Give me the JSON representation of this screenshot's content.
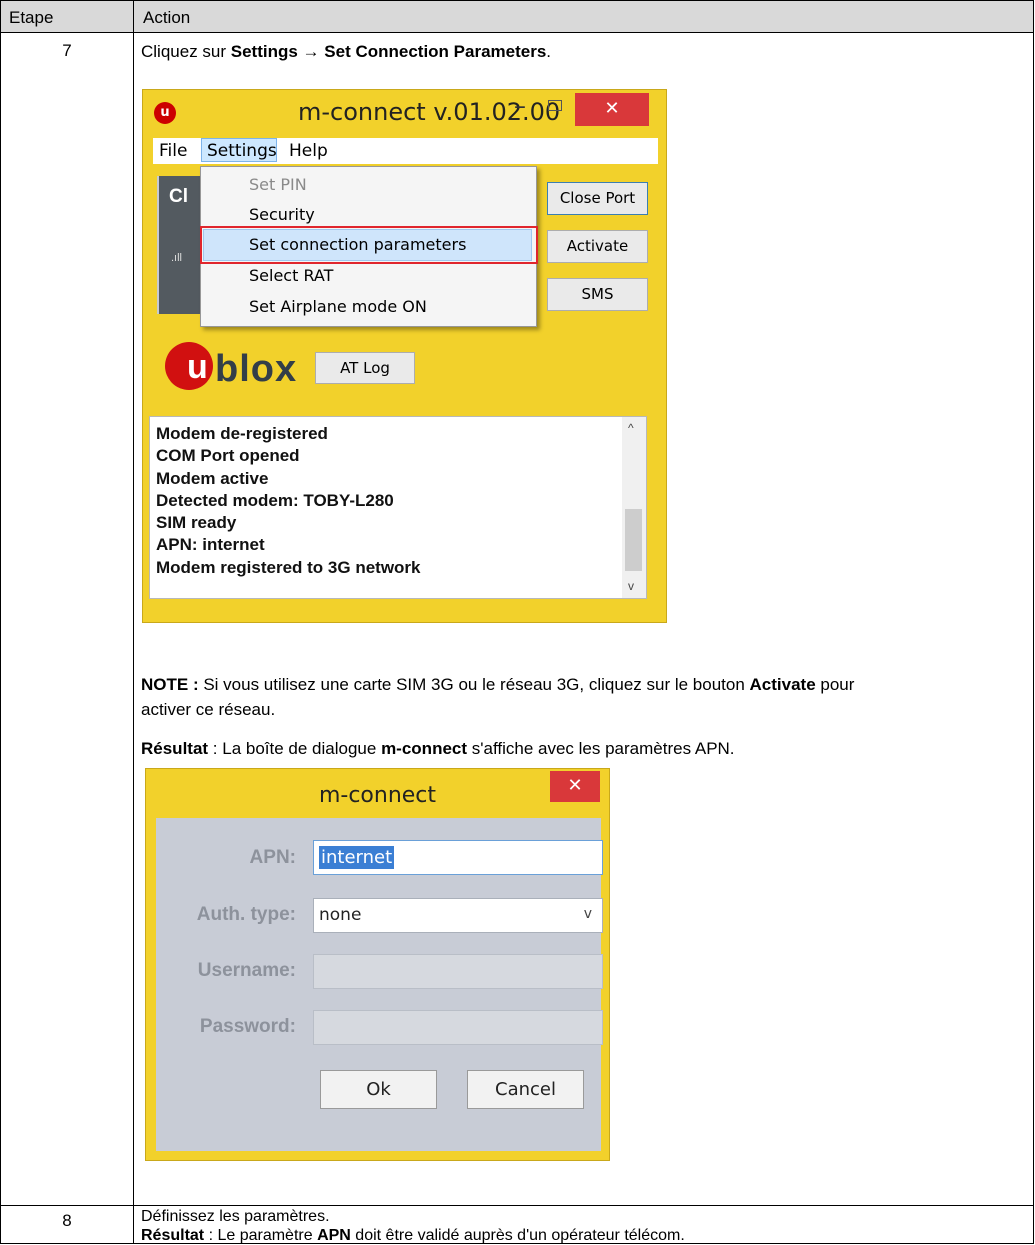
{
  "table": {
    "header": {
      "step": "Etape",
      "action": "Action"
    },
    "row7": {
      "step": "7",
      "instruction": {
        "prefix": "Cliquez sur ",
        "path": "Settings → Set Connection Parameters",
        "suffix": "."
      },
      "note": {
        "label": "NOTE :",
        "text1": " Si vous utilisez une carte SIM 3G ou le réseau 3G, cliquez sur le bouton ",
        "bold": "Activate",
        "text2": " pour",
        "line2": "activer ce réseau."
      },
      "result": {
        "label": "Résultat",
        "text1": " : La boîte de dialogue ",
        "bold": "m-connect",
        "text2": " s'affiche avec les paramètres APN."
      }
    },
    "row8": {
      "step": "8",
      "line1": "Définissez les paramètres.",
      "result": {
        "label": "Résultat",
        "text1": " : Le paramètre ",
        "bold": "APN",
        "text2": " doit être validé auprès d'un opérateur télécom."
      }
    }
  },
  "main_window": {
    "title": "m-connect v.01.02.00",
    "app_icon_letter": "u",
    "minimize": "–",
    "close": "✕",
    "menu": {
      "file": "File",
      "settings": "Settings",
      "help": "Help"
    },
    "dropdown_items": [
      {
        "label": "Set PIN",
        "disabled": true
      },
      {
        "label": "Security",
        "disabled": false
      },
      {
        "label": "Set connection parameters",
        "disabled": false,
        "highlighted": true
      },
      {
        "label": "Select RAT",
        "disabled": false
      },
      {
        "label": "Set Airplane mode ON",
        "disabled": false
      }
    ],
    "panel_text": "Cl",
    "signal_glyph": ".ıll",
    "buttons": {
      "close_port": "Close Port",
      "activate": "Activate",
      "sms": "SMS",
      "at_log": "AT Log"
    },
    "logo": {
      "mark": "u",
      "text": "blox"
    },
    "log_lines": [
      "Modem de-registered",
      "COM Port opened",
      "Modem active",
      "Detected modem: TOBY-L280",
      "SIM ready",
      "APN: internet",
      "Modem registered to 3G network"
    ],
    "scroll_up": "^",
    "scroll_down": "v"
  },
  "dialog": {
    "title": "m-connect",
    "close": "✕",
    "labels": {
      "apn": "APN:",
      "auth": "Auth. type:",
      "username": "Username:",
      "password": "Password:"
    },
    "values": {
      "apn": "internet",
      "auth": "none",
      "username": "",
      "password": ""
    },
    "combo_arrow": "v",
    "buttons": {
      "ok": "Ok",
      "cancel": "Cancel"
    }
  },
  "colors": {
    "window_frame": "#f2d12b",
    "close_red": "#d9383a",
    "highlight_box": "#e0262d",
    "header_gray": "#d9d9d9"
  }
}
